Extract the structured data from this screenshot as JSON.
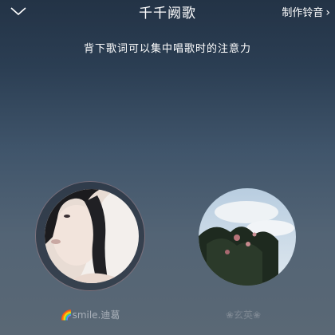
{
  "header": {
    "title": "千千阙歌",
    "ringtone_label": "制作铃音",
    "ringtone_arrow": "›"
  },
  "tip": "背下歌词可以集中唱歌时的注意力",
  "singers": [
    {
      "name": "🌈smile.迪葛",
      "active": true
    },
    {
      "name": "❀玄英❀",
      "active": false
    }
  ]
}
